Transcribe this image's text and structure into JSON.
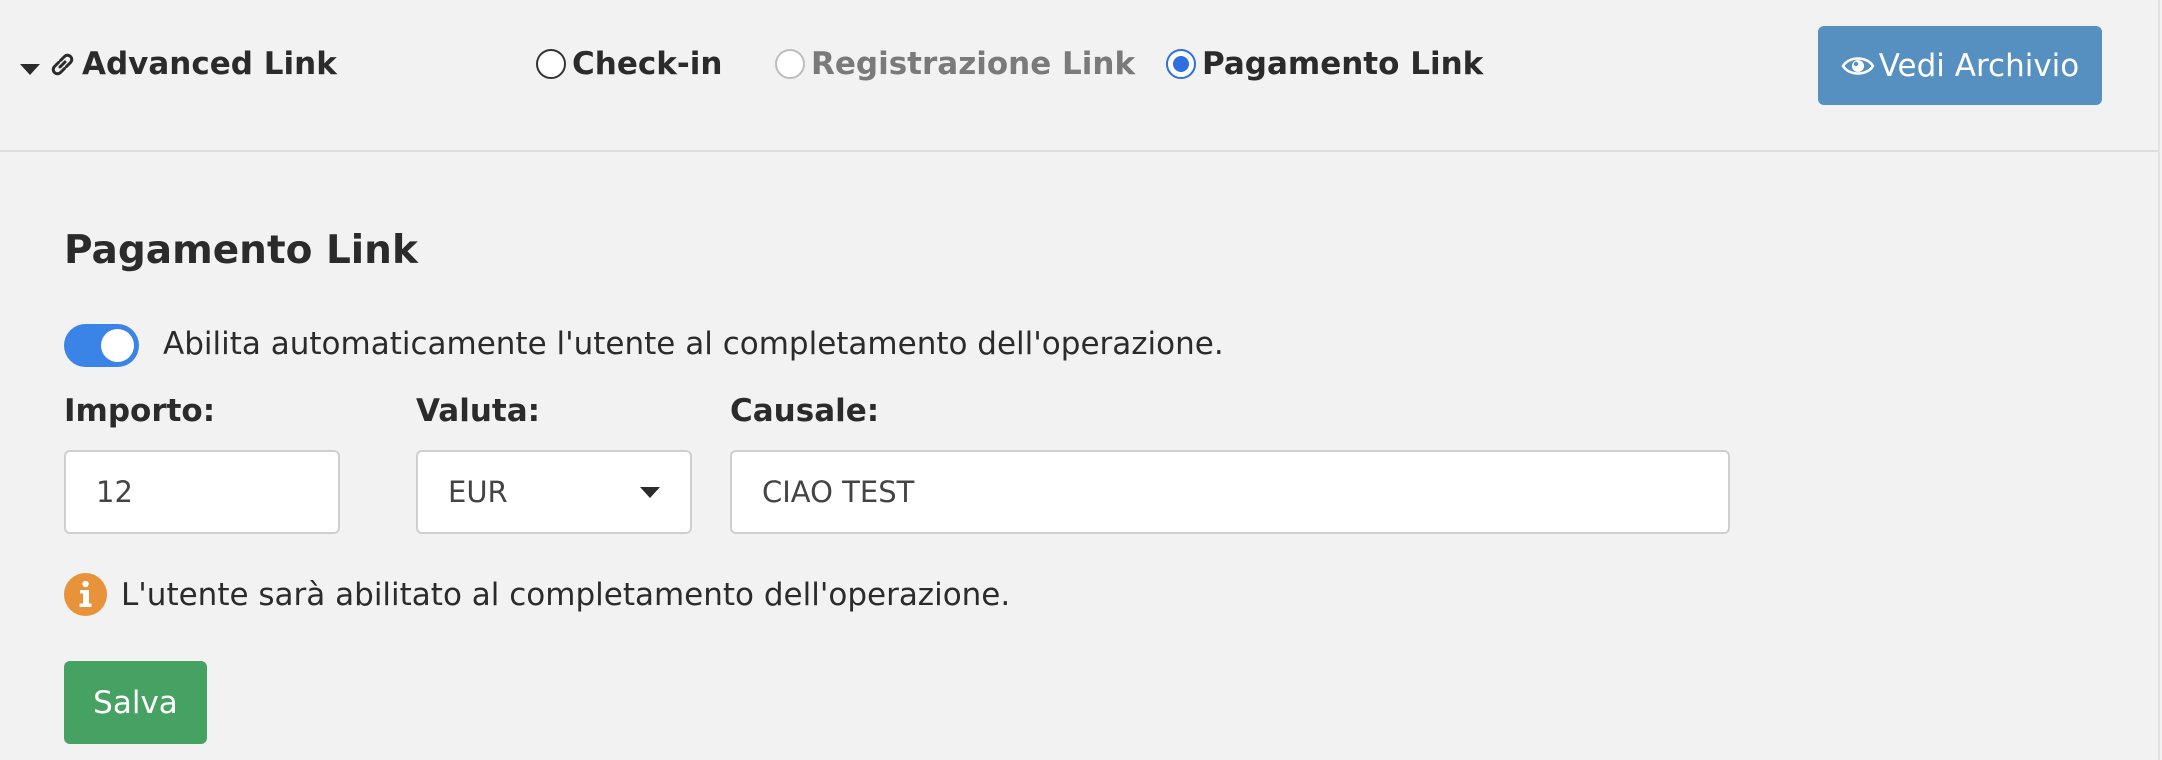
{
  "header": {
    "title": "Advanced Link",
    "options": [
      {
        "label": "Check-in",
        "checked": false,
        "disabled": false
      },
      {
        "label": "Registrazione Link",
        "checked": false,
        "disabled": true
      },
      {
        "label": "Pagamento Link",
        "checked": true,
        "disabled": false
      }
    ],
    "archive_button": "Vedi Archivio"
  },
  "form": {
    "section_title": "Pagamento Link",
    "toggle": {
      "on": true,
      "label": "Abilita automaticamente l'utente al completamento dell'operazione."
    },
    "importo": {
      "label": "Importo:",
      "value": "12"
    },
    "valuta": {
      "label": "Valuta:",
      "value": "EUR"
    },
    "causale": {
      "label": "Causale:",
      "value": "CIAO TEST"
    },
    "info_text": "L'utente sarà abilitato al completamento dell'operazione.",
    "save_button": "Salva"
  },
  "colors": {
    "primary_button": "#5590c0",
    "toggle_on": "#3a84e8",
    "radio_checked": "#2f6fe0",
    "info_icon": "#e8923a",
    "save_button": "#46a262"
  },
  "icons": {
    "collapse": "caret-down-icon",
    "title": "link-icon",
    "archive": "eye-icon",
    "info": "info-circle-icon"
  }
}
